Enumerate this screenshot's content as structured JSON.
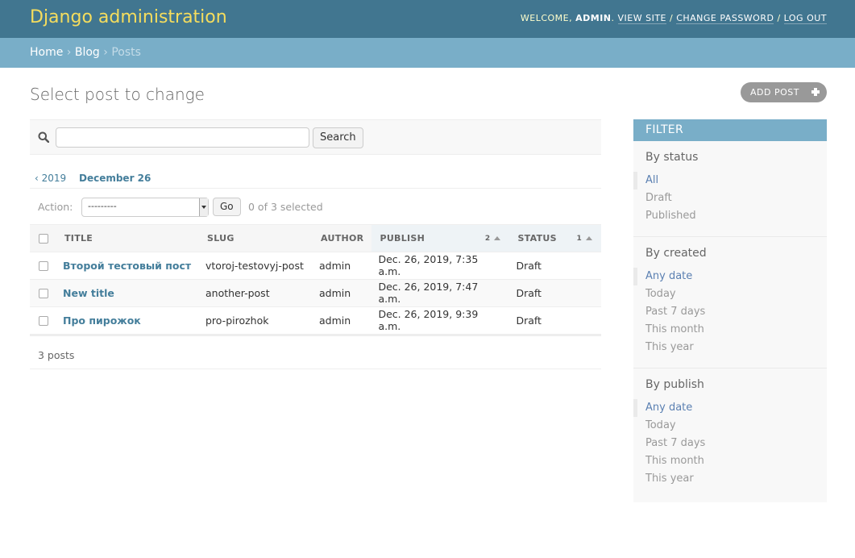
{
  "header": {
    "branding": "Django administration",
    "welcome": "WELCOME,",
    "username": "ADMIN",
    "view_site": "VIEW SITE",
    "change_password": "CHANGE PASSWORD",
    "log_out": "LOG OUT"
  },
  "breadcrumbs": {
    "home": "Home",
    "app": "Blog",
    "current": "Posts"
  },
  "page": {
    "title": "Select post to change",
    "add_button": "ADD POST"
  },
  "search": {
    "value": "",
    "button": "Search"
  },
  "date_hierarchy": {
    "back": "‹ 2019",
    "current": "December 26"
  },
  "actions": {
    "label": "Action:",
    "selected_option": "---------",
    "go": "Go",
    "selection_count": "0 of 3 selected"
  },
  "table": {
    "columns": {
      "title": "TITLE",
      "slug": "SLUG",
      "author": "AUTHOR",
      "publish": "PUBLISH",
      "status": "STATUS"
    },
    "sort": {
      "publish_priority": "2",
      "status_priority": "1"
    },
    "rows": [
      {
        "title": "Второй тестовый пост",
        "slug": "vtoroj-testovyj-post",
        "author": "admin",
        "publish": "Dec. 26, 2019, 7:35 a.m.",
        "status": "Draft"
      },
      {
        "title": "New title",
        "slug": "another-post",
        "author": "admin",
        "publish": "Dec. 26, 2019, 7:47 a.m.",
        "status": "Draft"
      },
      {
        "title": "Про пирожок",
        "slug": "pro-pirozhok",
        "author": "admin",
        "publish": "Dec. 26, 2019, 9:39 a.m.",
        "status": "Draft"
      }
    ]
  },
  "paginator": "3 posts",
  "filter": {
    "heading": "FILTER",
    "groups": [
      {
        "title": "By status",
        "items": [
          "All",
          "Draft",
          "Published"
        ]
      },
      {
        "title": "By created",
        "items": [
          "Any date",
          "Today",
          "Past 7 days",
          "This month",
          "This year"
        ]
      },
      {
        "title": "By publish",
        "items": [
          "Any date",
          "Today",
          "Past 7 days",
          "This month",
          "This year"
        ]
      }
    ]
  },
  "colors": {
    "header_bg": "#417690",
    "branding": "#f5dd5d",
    "breadcrumbs_bg": "#79aec8",
    "link": "#447e9b"
  }
}
